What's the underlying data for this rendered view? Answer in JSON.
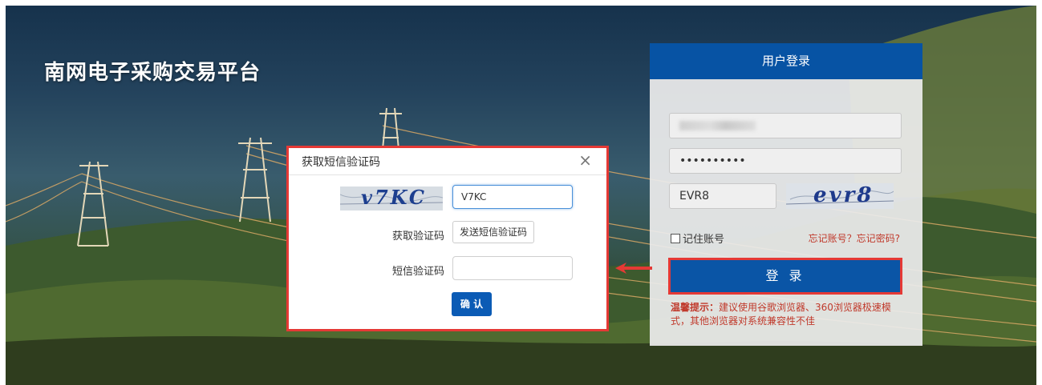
{
  "site": {
    "title": "南网电子采购交易平台"
  },
  "login": {
    "header": "用户登录",
    "password_value": "••••••••••",
    "captcha_value": "EVR8",
    "captcha_image_text": "evr8",
    "remember_label": "记住账号",
    "forgot_label": "忘记账号？忘记密码?",
    "login_button": "登 录",
    "tip_prefix": "温馨提示：",
    "tip_text": "建议使用谷歌浏览器、360浏览器极速模式，其他浏览器对系统兼容性不佳"
  },
  "sms_dialog": {
    "title": "获取短信验证码",
    "close_symbol": "×",
    "captcha_image_text": "v7KC",
    "captcha_value": "V7KC",
    "get_code_label": "获取验证码",
    "send_button": "发送短信验证码",
    "sms_code_label": "短信验证码",
    "sms_code_value": "",
    "confirm_button": "确 认"
  },
  "colors": {
    "primary": "#0753a4",
    "highlight": "#e53935",
    "tip": "#c0392b"
  },
  "icons": {
    "close": "close-icon",
    "arrow": "arrow-left-icon"
  }
}
